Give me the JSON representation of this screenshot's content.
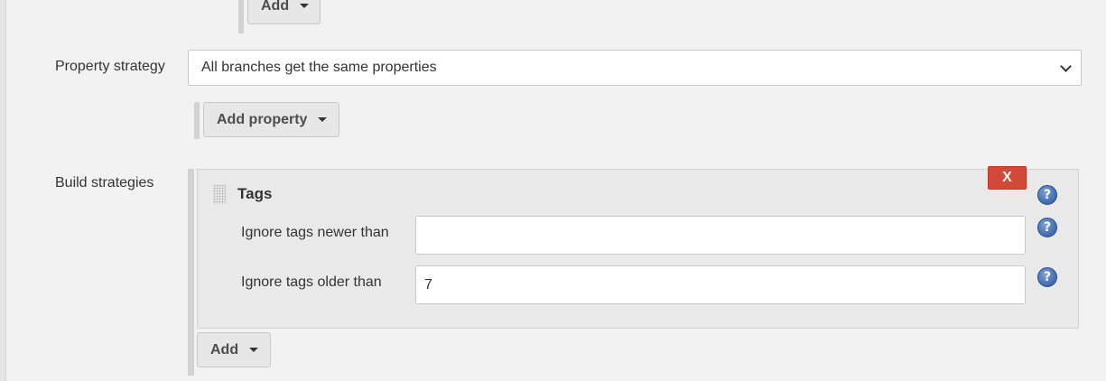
{
  "top_add_button": {
    "label": "Add"
  },
  "property_strategy": {
    "label": "Property strategy",
    "selected": "All branches get the same properties",
    "add_property_label": "Add property"
  },
  "build_strategies": {
    "label": "Build strategies",
    "tags_panel": {
      "title": "Tags",
      "delete_label": "X",
      "fields": [
        {
          "label": "Ignore tags newer than",
          "value": ""
        },
        {
          "label": "Ignore tags older than",
          "value": "7"
        }
      ],
      "help_glyph": "?"
    },
    "add_label": "Add"
  }
}
